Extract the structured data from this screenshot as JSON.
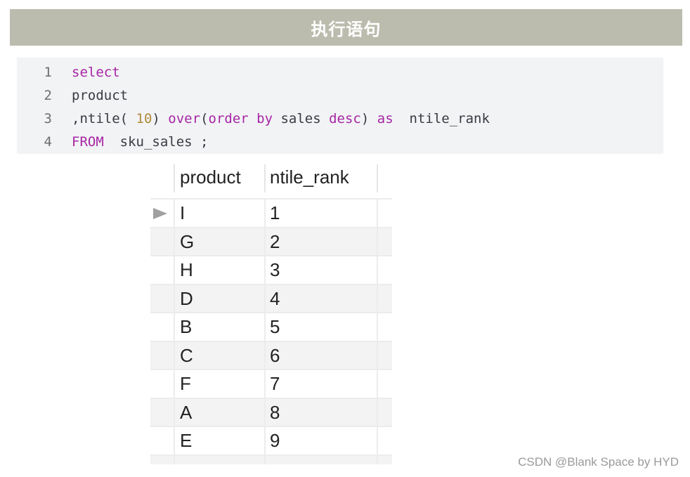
{
  "banner": {
    "title": "执行语句",
    "color": "#bbbcad"
  },
  "code": {
    "lines": [
      {
        "num": "1",
        "parts": [
          {
            "t": "select",
            "k": "kw"
          }
        ]
      },
      {
        "num": "2",
        "parts": [
          {
            "t": "product",
            "k": ""
          }
        ]
      },
      {
        "num": "3",
        "parts": [
          {
            "t": ",ntile( ",
            "k": ""
          },
          {
            "t": "10",
            "k": "num"
          },
          {
            "t": ") ",
            "k": ""
          },
          {
            "t": "over",
            "k": "kw"
          },
          {
            "t": "(",
            "k": ""
          },
          {
            "t": "order by",
            "k": "kw"
          },
          {
            "t": " sales ",
            "k": ""
          },
          {
            "t": "desc",
            "k": "kw"
          },
          {
            "t": ") ",
            "k": ""
          },
          {
            "t": "as",
            "k": "kw"
          },
          {
            "t": "  ntile_rank",
            "k": ""
          }
        ]
      },
      {
        "num": "4",
        "parts": [
          {
            "t": "FROM",
            "k": "kw"
          },
          {
            "t": "  sku_sales ;",
            "k": ""
          }
        ]
      }
    ]
  },
  "table": {
    "columns": [
      "product",
      "ntile_rank"
    ],
    "rows": [
      {
        "product": "I",
        "ntile_rank": "1",
        "current": true
      },
      {
        "product": "G",
        "ntile_rank": "2"
      },
      {
        "product": "H",
        "ntile_rank": "3"
      },
      {
        "product": "D",
        "ntile_rank": "4"
      },
      {
        "product": "B",
        "ntile_rank": "5"
      },
      {
        "product": "C",
        "ntile_rank": "6"
      },
      {
        "product": "F",
        "ntile_rank": "7"
      },
      {
        "product": "A",
        "ntile_rank": "8"
      },
      {
        "product": "E",
        "ntile_rank": "9"
      }
    ]
  },
  "watermark": "CSDN @Blank Space by HYD"
}
